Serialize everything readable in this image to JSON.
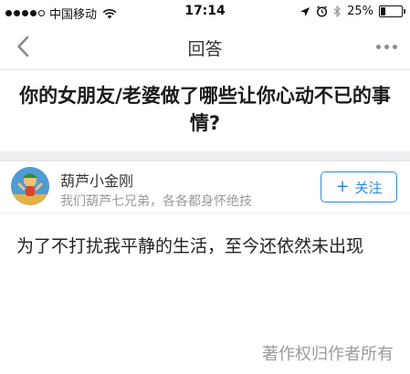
{
  "status_bar": {
    "carrier": "中国移动",
    "time": "17:14",
    "battery_percent": "25%",
    "battery_level": 0.25,
    "signal_bars_filled": 4,
    "signal_bars_total": 5
  },
  "nav": {
    "title": "回答",
    "back_icon": "chevron-left-icon",
    "more_icon": "more-horizontal-icon"
  },
  "question": {
    "text": "你的女朋友/老婆做了哪些让你心动不已的事情?"
  },
  "author": {
    "name": "葫芦小金刚",
    "bio": "我们葫芦七兄弟，各各都身怀绝技",
    "follow_icon": "+",
    "follow_label": "关注"
  },
  "answer": {
    "text": "为了不打扰我平静的生活，至今还依然未出现"
  },
  "footer": {
    "copyright": "著作权归作者所有"
  },
  "colors": {
    "accent": "#2e88e6",
    "muted_text": "#9a9a9a",
    "divider": "#eeeef0"
  }
}
